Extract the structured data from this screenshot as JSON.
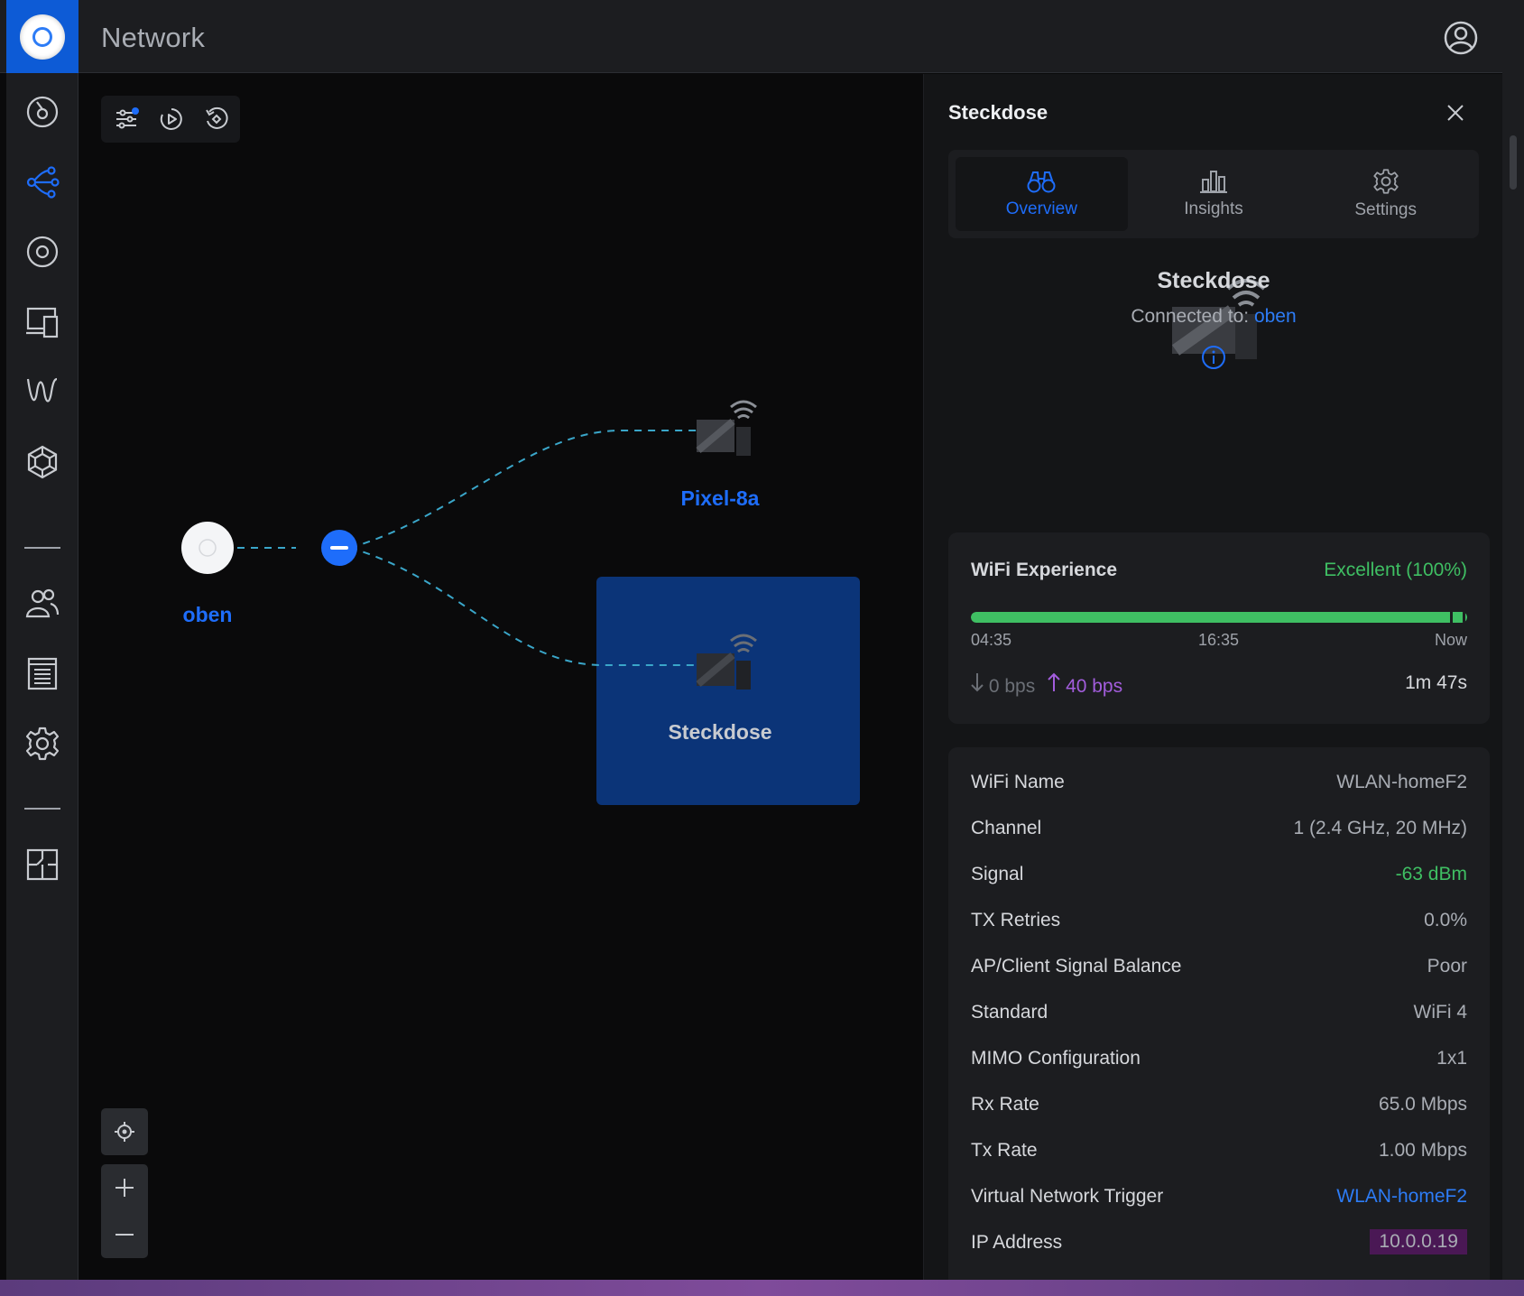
{
  "app": {
    "title": "Network"
  },
  "toolbar": {
    "icons": [
      "filter-icon",
      "play-icon",
      "reset-icon"
    ]
  },
  "topology": {
    "nodes": {
      "ap": {
        "label": "oben"
      },
      "client1": {
        "label": "Pixel-8a"
      },
      "client2": {
        "label": "Steckdose"
      }
    }
  },
  "panel": {
    "title": "Steckdose",
    "tabs": [
      {
        "label": "Overview",
        "icon": "binoculars-icon",
        "active": true
      },
      {
        "label": "Insights",
        "icon": "bar-chart-icon",
        "active": false
      },
      {
        "label": "Settings",
        "icon": "gear-icon",
        "active": false
      }
    ],
    "device_name": "Steckdose",
    "connected_label": "Connected to:",
    "connected_to": "oben",
    "wifi_experience": {
      "title": "WiFi Experience",
      "status": "Excellent (100%)",
      "progress": 1.0,
      "time_start": "04:35",
      "time_mid": "16:35",
      "time_end": "Now",
      "down": "0 bps",
      "up": "40 bps",
      "uptime": "1m 47s"
    },
    "details": [
      {
        "key": "WiFi Name",
        "value": "WLAN-homeF2",
        "style": ""
      },
      {
        "key": "Channel",
        "value": "1 (2.4 GHz, 20 MHz)",
        "style": ""
      },
      {
        "key": "Signal",
        "value": "-63 dBm",
        "style": "green"
      },
      {
        "key": "TX Retries",
        "value": "0.0%",
        "style": ""
      },
      {
        "key": "AP/Client Signal Balance",
        "value": "Poor",
        "style": ""
      },
      {
        "key": "Standard",
        "value": "WiFi 4",
        "style": ""
      },
      {
        "key": "MIMO Configuration",
        "value": "1x1",
        "style": ""
      },
      {
        "key": "Rx Rate",
        "value": "65.0 Mbps",
        "style": ""
      },
      {
        "key": "Tx Rate",
        "value": "1.00 Mbps",
        "style": ""
      },
      {
        "key": "Virtual Network Trigger",
        "value": "WLAN-homeF2",
        "style": "blue"
      },
      {
        "key": "IP Address",
        "value": "10.0.0.19",
        "style": "hl"
      }
    ]
  },
  "colors": {
    "accent": "#1e6dfa",
    "success": "#3fbf63",
    "upload": "#a25ddc",
    "selection": "#0b3478"
  }
}
